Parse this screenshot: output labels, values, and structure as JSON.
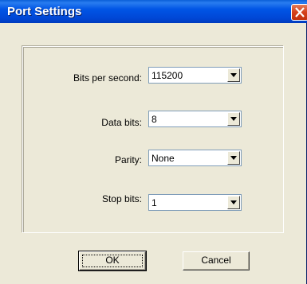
{
  "dialog": {
    "title": "Port Settings",
    "close_icon": "close-icon"
  },
  "fields": {
    "bits_per_second": {
      "label": "Bits per second:",
      "value": "115200"
    },
    "data_bits": {
      "label": "Data bits:",
      "value": "8"
    },
    "parity": {
      "label": "Parity:",
      "value": "None"
    },
    "stop_bits": {
      "label": "Stop bits:",
      "value": "1"
    }
  },
  "buttons": {
    "ok": "OK",
    "cancel": "Cancel"
  },
  "colors": {
    "title_bar": "#0055e5",
    "close_button": "#d4401a",
    "dialog_bg": "#ece9d8"
  }
}
